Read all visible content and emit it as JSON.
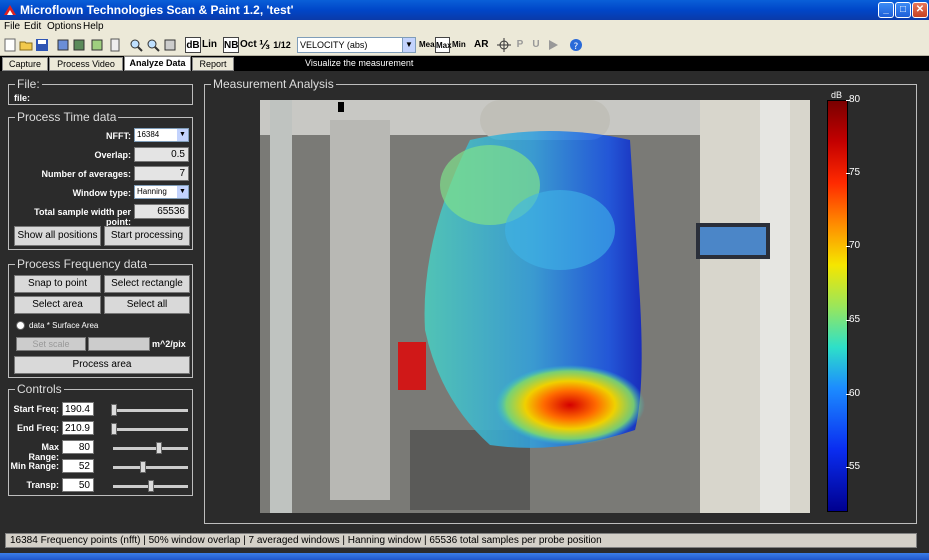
{
  "window": {
    "title": "Microflown Technologies Scan & Paint 1.2, 'test'"
  },
  "menu": [
    "File",
    "Edit",
    "Options",
    "Help"
  ],
  "toolbar": {
    "db": "dB",
    "lin": "Lin",
    "nb": "NB",
    "oct": "Oct",
    "third": "⅓",
    "twelfth": "1/12",
    "quantity": "VELOCITY (abs)",
    "mea": "Mea",
    "max": "Max",
    "min": "Min",
    "ar": "AR",
    "p": "P",
    "u": "U"
  },
  "tabs": [
    "Capture",
    "Process Video",
    "Analyze Data",
    "Report"
  ],
  "active_tab": "Analyze Data",
  "tab_hint": "Visualize the measurement",
  "file_panel": {
    "legend": "File:",
    "label": "file:"
  },
  "process_time": {
    "legend": "Process Time data",
    "nfft_label": "NFFT:",
    "nfft_value": "16384",
    "overlap_label": "Overlap:",
    "overlap_value": "0.5",
    "averages_label": "Number of averages:",
    "averages_value": "7",
    "window_label": "Window type:",
    "window_value": "Hanning",
    "total_label": "Total sample width per point:",
    "total_value": "65536",
    "show_all": "Show all positions",
    "start_processing": "Start processing"
  },
  "process_freq": {
    "legend": "Process Frequency data",
    "snap": "Snap to point",
    "select_rect": "Select rectangle",
    "select_area": "Select area",
    "select_all": "Select all",
    "radio_label": "data * Surface Area",
    "set_scale": "Set scale",
    "units": "m^2/pix",
    "process_area": "Process area"
  },
  "controls": {
    "legend": "Controls",
    "start_freq_label": "Start Freq:",
    "start_freq": "190.4",
    "end_freq_label": "End Freq:",
    "end_freq": "210.9",
    "max_range_label": "Max Range:",
    "max_range": "80",
    "min_range_label": "Min Range:",
    "min_range": "52",
    "transp_label": "Transp:",
    "transp": "50"
  },
  "analysis": {
    "legend": "Measurement Analysis"
  },
  "colorbar": {
    "unit": "dB",
    "ticks": [
      "80",
      "75",
      "70",
      "65",
      "60",
      "55"
    ]
  },
  "status": "16384 Frequency points (nfft)  |  50% window overlap  |  7 averaged windows  |  Hanning window  |  65536 total samples per probe position"
}
